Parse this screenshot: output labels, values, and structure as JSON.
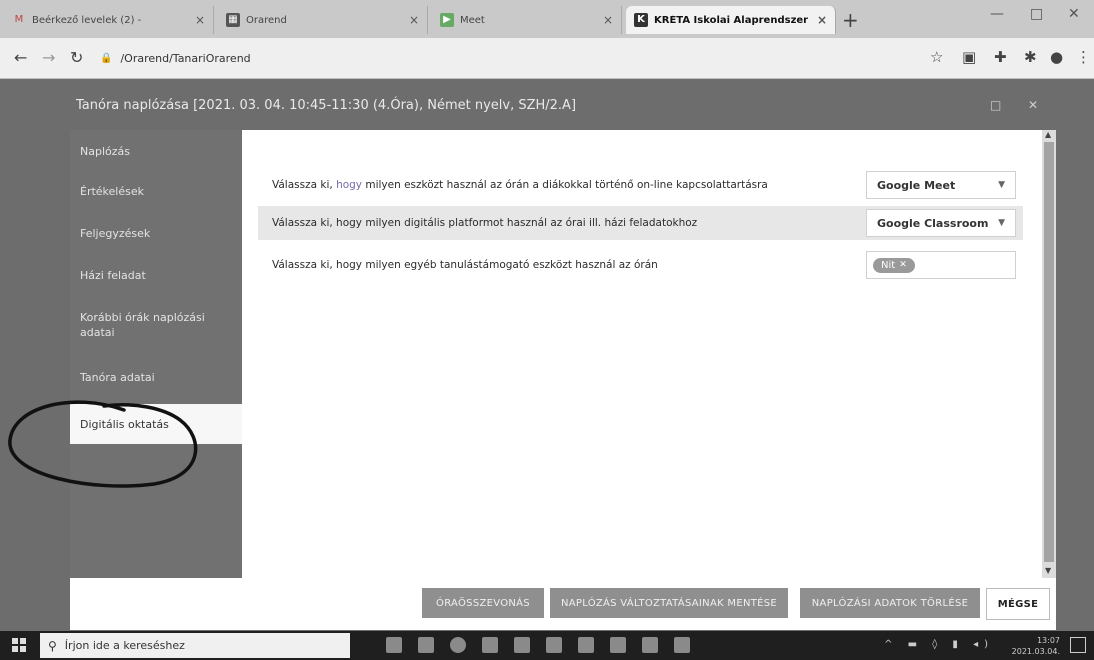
{
  "browser": {
    "tabs": [
      {
        "label": "Beérkező levelek (2) - ",
        "icon": "gmail-icon",
        "active": false
      },
      {
        "label": "Órarend",
        "icon": "calendar-icon",
        "active": false
      },
      {
        "label": "Meet",
        "icon": "meet-icon",
        "active": false
      },
      {
        "label": "KRÉTA Iskolai Alaprendszer",
        "icon": "kreta-icon",
        "active": true
      }
    ],
    "new_tab": "+",
    "url": "/Orarend/TanariOrarend"
  },
  "modal": {
    "title": "Tanóra naplózása [2021. 03. 04. 10:45-11:30 (4.Óra), Német nyelv, SZH/2.A]"
  },
  "sidebar": {
    "items": [
      {
        "label": "Naplózás"
      },
      {
        "label": "Értékelések"
      },
      {
        "label": "Feljegyzések"
      },
      {
        "label": "Házi feladat"
      },
      {
        "label": "Korábbi órák naplózási adatai"
      },
      {
        "label": "Tanóra adatai"
      },
      {
        "label": "Digitális oktatás",
        "active": true
      }
    ]
  },
  "content": {
    "rows": [
      {
        "question_prefix": "Válassza ki, ",
        "question_highlight": "hogy",
        "question_suffix": " milyen eszközt használ az órán a diákokkal történő on-line kapcsolattartásra",
        "value": "Google Meet"
      },
      {
        "question_prefix": "Válassza ki, hogy milyen digitális platformot használ az órai ill. házi feladatokhoz",
        "question_highlight": "",
        "question_suffix": "",
        "value": "Google Classroom"
      },
      {
        "question_prefix": "Válassza ki, hogy milyen egyéb tanulástámogató eszközt használ az órán",
        "question_highlight": "",
        "question_suffix": "",
        "chip": "Nit"
      }
    ]
  },
  "footer": {
    "buttons": [
      "ÓRAÖSSZEVONÁS",
      "NAPLÓZÁS VÁLTOZTATÁSAINAK MENTÉSE",
      "NAPLÓZÁSI ADATOK TÖRLÉSE",
      "MÉGSE"
    ]
  },
  "taskbar": {
    "search_placeholder": "Írjon ide a kereséshez",
    "time": "13:07",
    "date": "2021.03.04."
  }
}
